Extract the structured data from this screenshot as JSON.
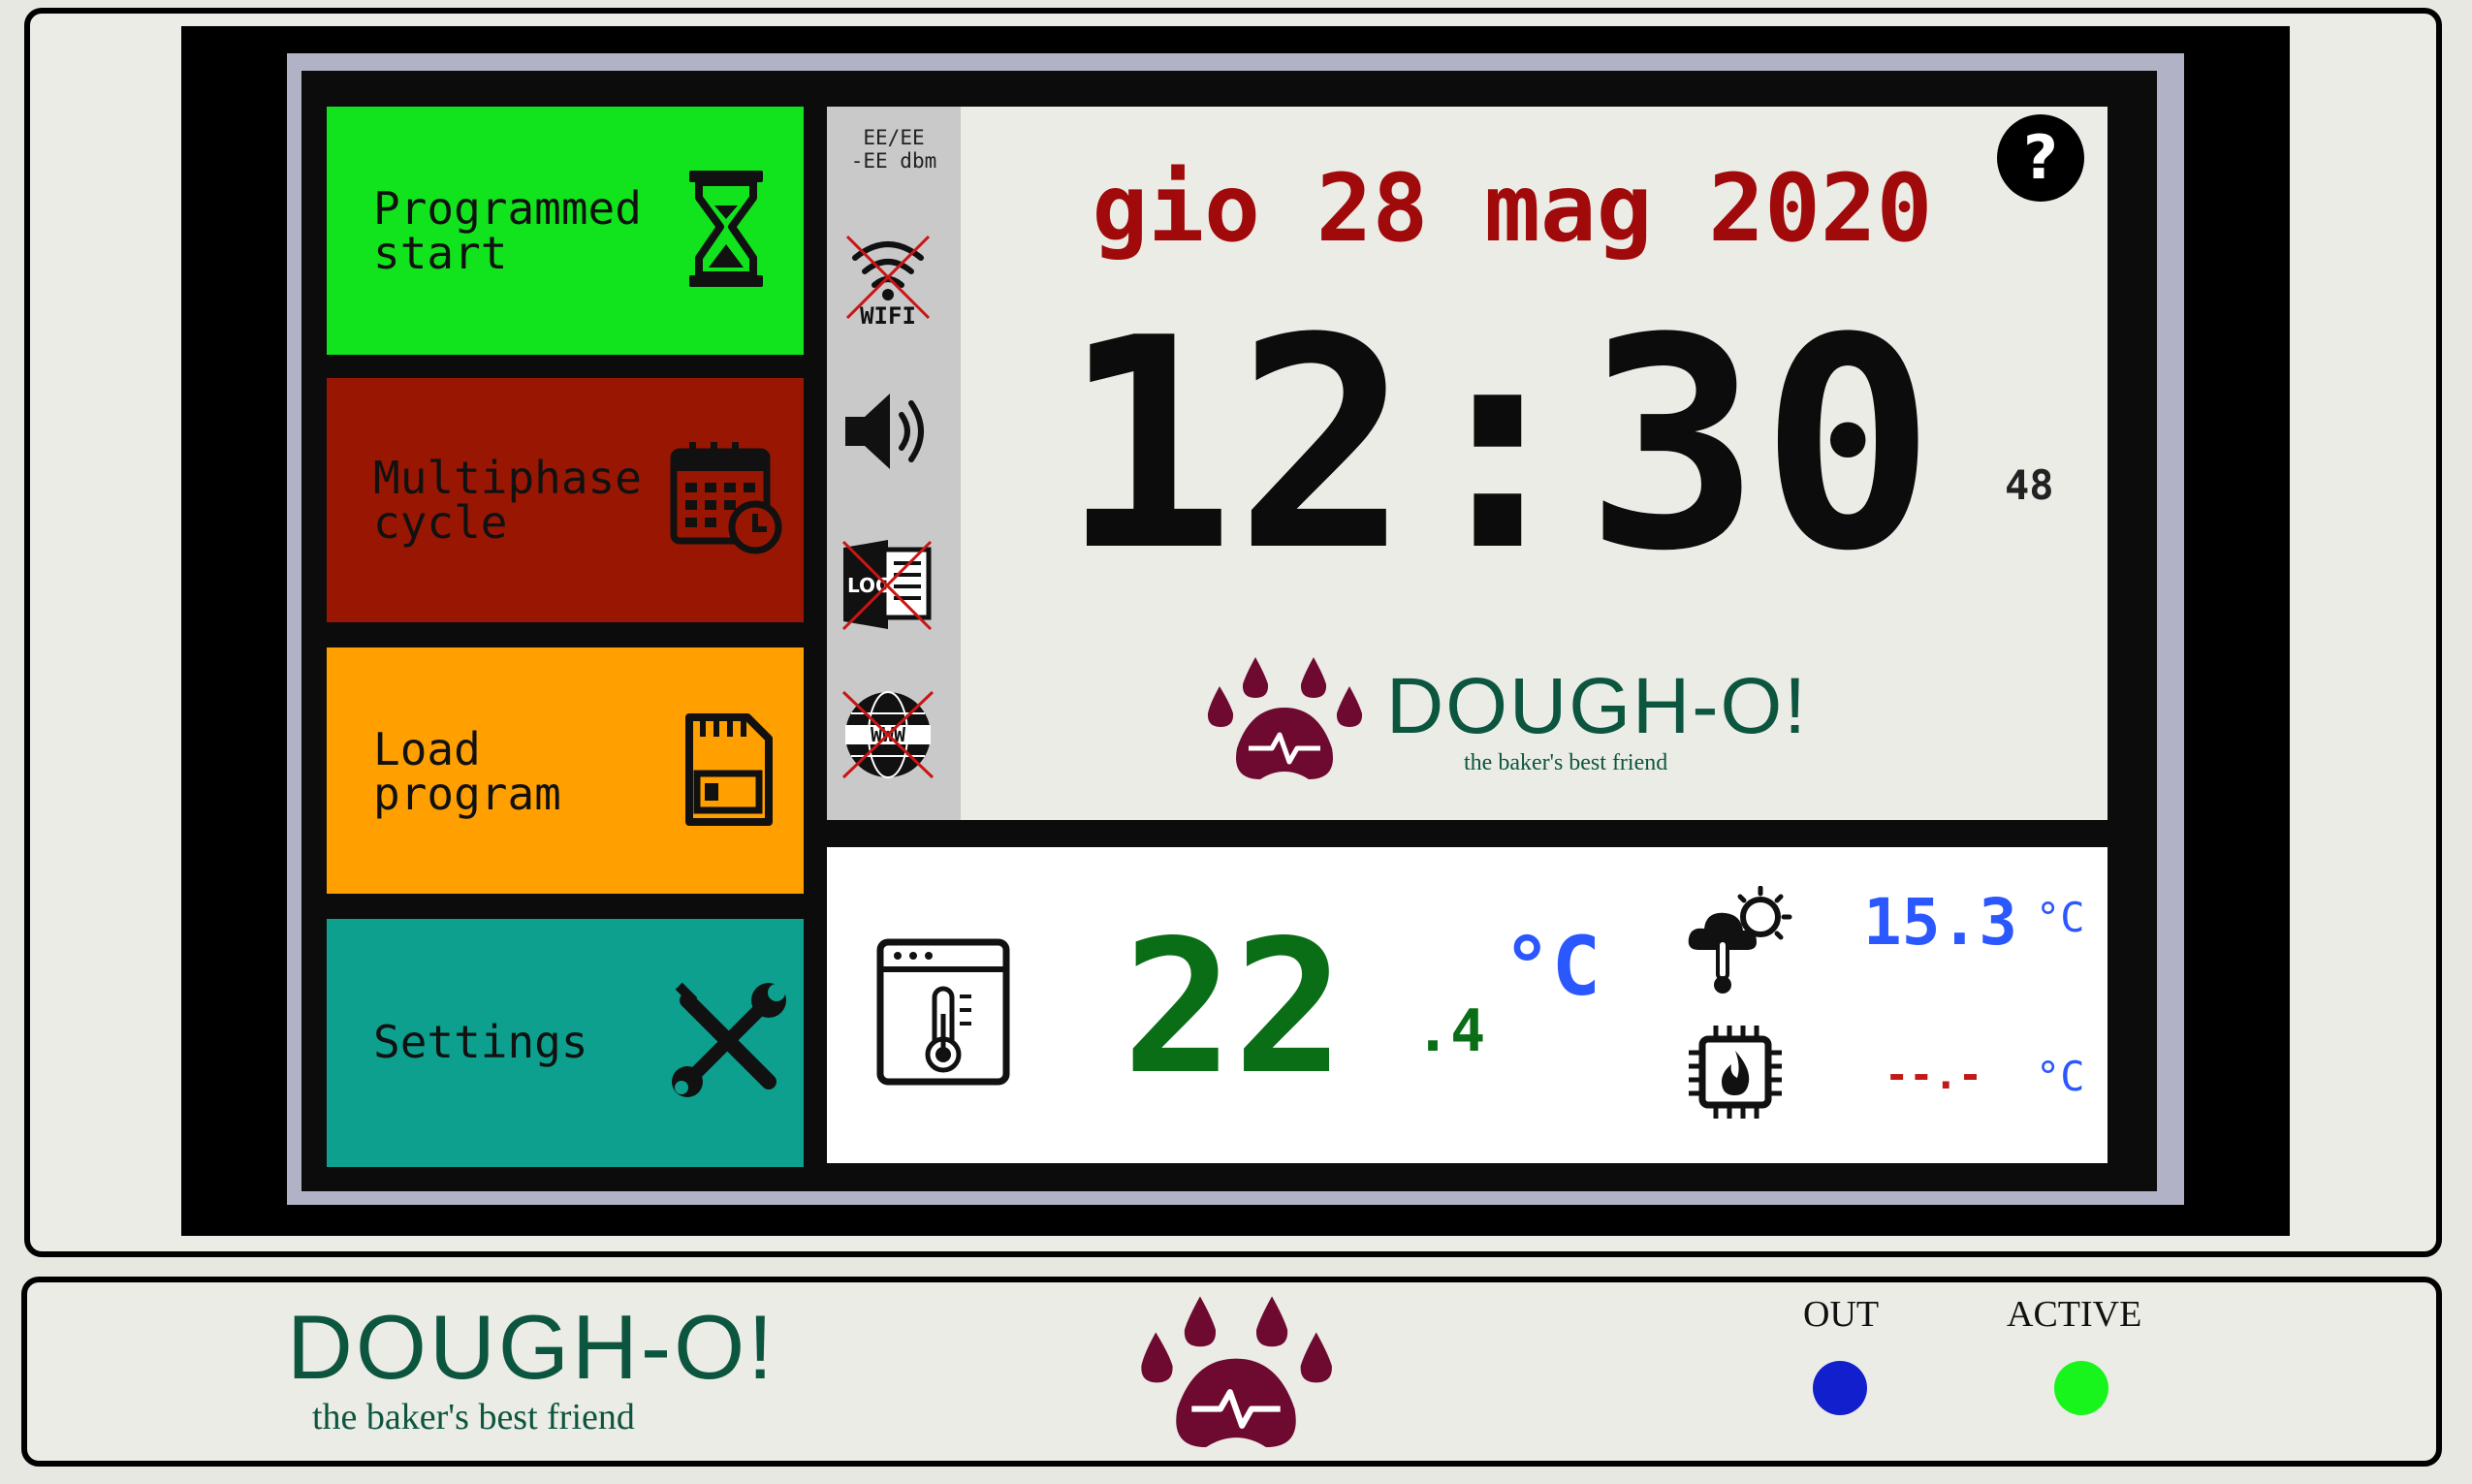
{
  "menu": {
    "programmed_start": "Programmed\nstart",
    "multiphase_cycle": "Multiphase\ncycle",
    "load_program": "Load\nprogram",
    "settings": "Settings"
  },
  "status": {
    "signal_text": "EE/EE\n-EE dbm",
    "wifi_label": "WIFI",
    "log_label": "LOG",
    "www_label": "WWW"
  },
  "clock": {
    "date": "gio 28 mag 2020",
    "time": "12:30",
    "seconds": "48"
  },
  "brand": {
    "name": "DOUGH-O!",
    "tagline": "the baker's best friend"
  },
  "temperature": {
    "main_integer": "22",
    "main_decimal": ".4",
    "main_unit": "°C",
    "outdoor_value": "15.3",
    "outdoor_unit": "°C",
    "cpu_value": "--.-",
    "cpu_unit": "°C"
  },
  "footer": {
    "brand_name": "DOUGH-O!",
    "tagline": "the baker's best friend",
    "out_label": "OUT",
    "active_label": "ACTIVE"
  },
  "colors": {
    "programmed_start_bg": "#11e41d",
    "multiphase_bg": "#991702",
    "load_program_bg": "#ff9f00",
    "settings_bg": "#0da08f",
    "date_color": "#a10a0a",
    "temp_main_color": "#0a6e17",
    "temp_unit_color": "#2b57ff",
    "cpu_temp_color": "#c21818",
    "brand_color": "#0c553f",
    "paw_color": "#6e0a30",
    "out_led": "#121fcc",
    "active_led": "#18f51c"
  },
  "icons": {
    "programmed_start": "hourglass-icon",
    "multiphase_cycle": "calendar-clock-icon",
    "load_program": "sd-card-icon",
    "settings": "tools-icon",
    "help": "help-icon",
    "wifi": "wifi-off-icon",
    "speaker": "speaker-icon",
    "log": "log-off-icon",
    "www": "www-off-icon",
    "oven": "oven-thermometer-icon",
    "weather": "weather-thermometer-icon",
    "cpu": "cpu-flame-icon",
    "paw": "paw-icon"
  }
}
